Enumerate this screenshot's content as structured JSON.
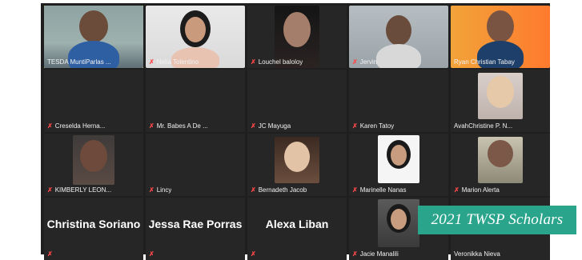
{
  "tiles": [
    {
      "name": "TESDA MuntiParlas ...",
      "muted": false,
      "has_video": true,
      "active": true
    },
    {
      "name": "Nelia Tolentino",
      "muted": true,
      "has_video": true
    },
    {
      "name": "Louchel baloloy",
      "muted": true,
      "has_video": true
    },
    {
      "name": "Jervin",
      "muted": true,
      "has_video": true
    },
    {
      "name": "Ryan Christian Tabay",
      "muted": false,
      "has_video": true
    },
    {
      "name": "Creselda Herna...",
      "muted": true,
      "has_video": false
    },
    {
      "name": "Mr. Babes A De ...",
      "muted": true,
      "has_video": false
    },
    {
      "name": "JC Mayuga",
      "muted": true,
      "has_video": false
    },
    {
      "name": "Karen Tatoy",
      "muted": true,
      "has_video": false
    },
    {
      "name": "AvahChristine P. N...",
      "muted": false,
      "has_video": true
    },
    {
      "name": "KIMBERLY LEON...",
      "muted": true,
      "has_video": true
    },
    {
      "name": "Lincy",
      "muted": true,
      "has_video": false
    },
    {
      "name": "Bernadeth Jacob",
      "muted": true,
      "has_video": true
    },
    {
      "name": "Marinelle Nanas",
      "muted": true,
      "has_video": true
    },
    {
      "name": "Marion Alerta",
      "muted": true,
      "has_video": true
    },
    {
      "name": "",
      "display_name": "Christina Soriano",
      "muted": true,
      "has_video": false
    },
    {
      "name": "",
      "display_name": "Jessa Rae Porras",
      "muted": true,
      "has_video": false
    },
    {
      "name": "",
      "display_name": "Alexa Liban",
      "muted": true,
      "has_video": false
    },
    {
      "name": "Jacie Manalili",
      "muted": true,
      "has_video": true
    },
    {
      "name": "Veronikka Nieva",
      "muted": false,
      "has_video": false
    }
  ],
  "banner": {
    "text": "2021 TWSP Scholars"
  },
  "icons": {
    "muted_mic": "muted-mic-icon"
  },
  "colors": {
    "tile_bg": "#262626",
    "active_outline": "#b7d34d",
    "muted_icon": "#ff4848",
    "banner_bg": "#2aa58c"
  }
}
